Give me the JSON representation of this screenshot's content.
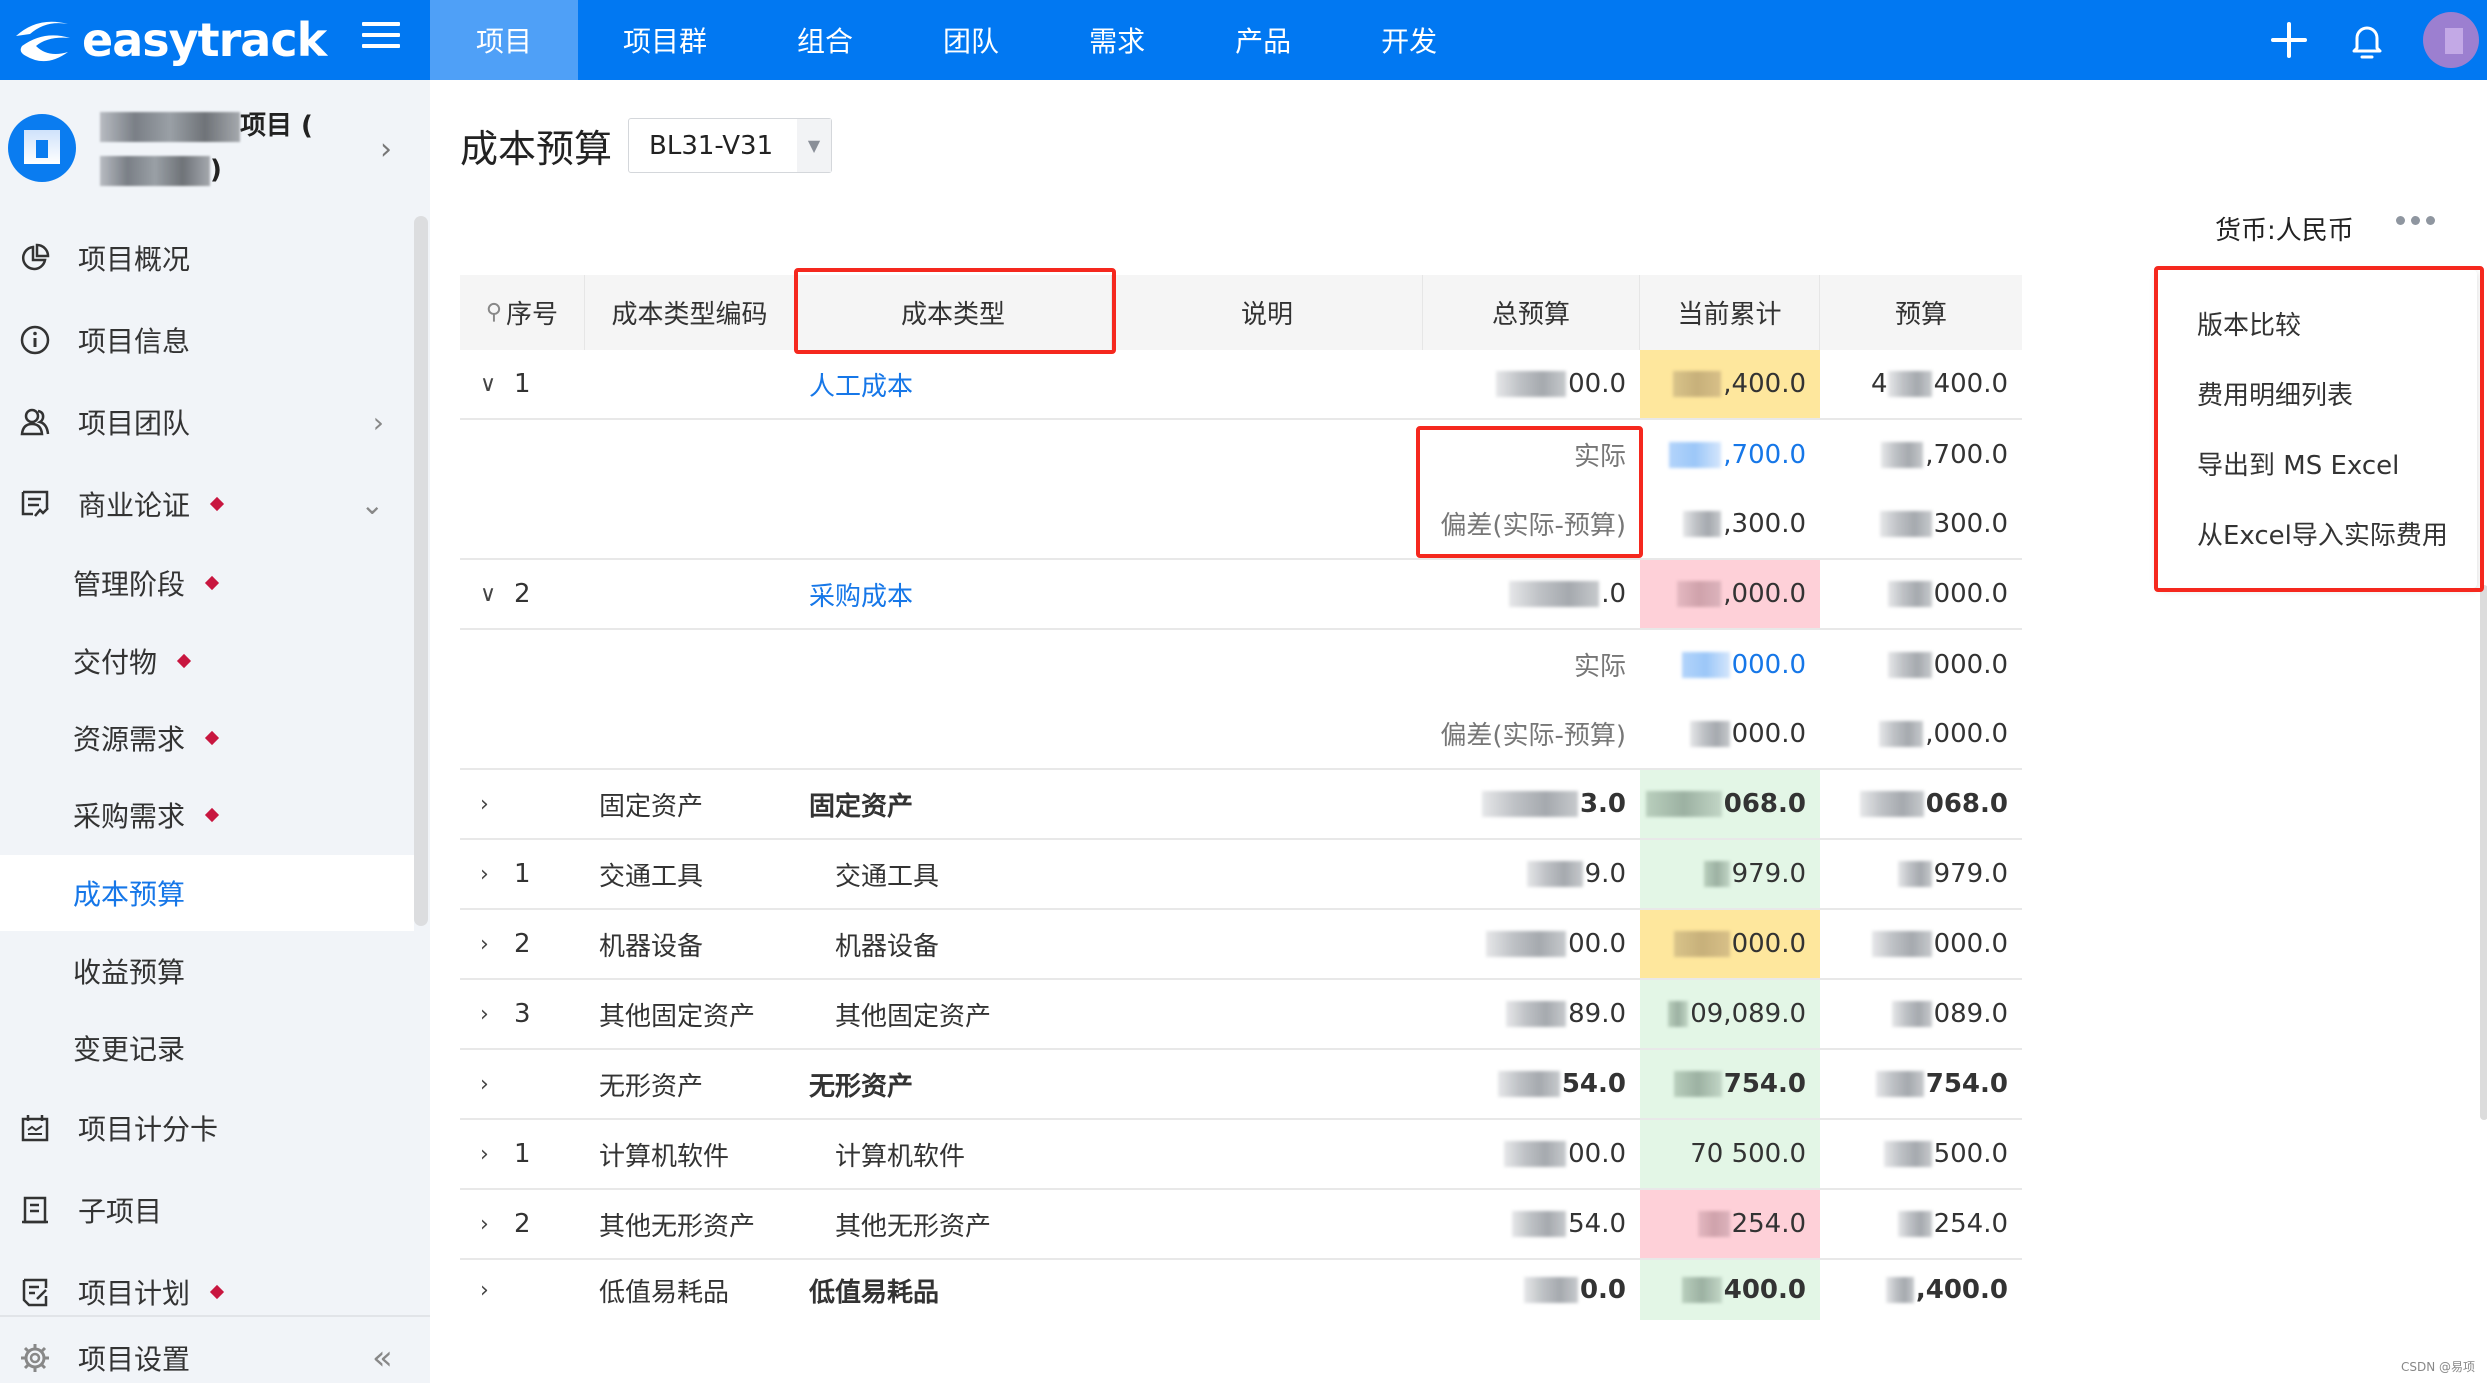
{
  "app": {
    "brand": "easytrack",
    "nav_tabs": [
      {
        "label": "项目",
        "active": true
      },
      {
        "label": "项目群"
      },
      {
        "label": "组合"
      },
      {
        "label": "团队"
      },
      {
        "label": "需求"
      },
      {
        "label": "产品"
      },
      {
        "label": "开发"
      }
    ],
    "icons": {
      "add": "plus-icon",
      "notifications": "bell-icon",
      "user": "avatar"
    }
  },
  "sidebar": {
    "project_name_visible": "项目 (",
    "project_name_line2_visible": ")",
    "items": [
      {
        "label": "项目概况",
        "icon": "pie-chart-icon"
      },
      {
        "label": "项目信息",
        "icon": "info-icon"
      },
      {
        "label": "项目团队",
        "icon": "team-icon",
        "chevron": "›"
      },
      {
        "label": "商业论证",
        "icon": "business-case-icon",
        "marker": true,
        "chevron": "⌄"
      },
      {
        "label": "管理阶段",
        "marker": true
      },
      {
        "label": "交付物",
        "marker": true
      },
      {
        "label": "资源需求",
        "marker": true
      },
      {
        "label": "采购需求",
        "marker": true
      },
      {
        "label": "成本预算",
        "active": true
      },
      {
        "label": "收益预算"
      },
      {
        "label": "变更记录"
      },
      {
        "label": "项目计分卡",
        "icon": "scorecard-icon"
      },
      {
        "label": "子项目",
        "icon": "subproject-icon"
      },
      {
        "label": "项目计划",
        "icon": "plan-icon",
        "marker": true
      },
      {
        "label": "项目设置",
        "icon": "settings-icon"
      }
    ],
    "collapse_label": "«"
  },
  "page": {
    "title": "成本预算",
    "version_select": {
      "value": "BL31-V31"
    },
    "currency_label": "货币:人民币",
    "more_label": "更多"
  },
  "table": {
    "columns": [
      "序号",
      "成本类型编码",
      "成本类型",
      "说明",
      "总预算",
      "当前累计",
      "预算"
    ],
    "sub_labels": {
      "actual": "实际",
      "variance": "偏差(实际-预算)"
    },
    "rows": [
      {
        "seq": "1",
        "expanded": true,
        "code": "",
        "type": "人工成本",
        "style": "link",
        "total": "00.0",
        "current": ",400.0",
        "current_bg": "yellow",
        "budget": "400.0",
        "actual": {
          "current": ",700.0",
          "budget": ",700.0"
        },
        "variance": {
          "current": ",300.0",
          "budget": "300.0"
        }
      },
      {
        "seq": "2",
        "expanded": true,
        "code": "",
        "type": "采购成本",
        "style": "link",
        "total": ".0",
        "current": ",000.0",
        "current_bg": "pink",
        "budget": "000.0",
        "actual": {
          "current": "000.0",
          "budget": "000.0"
        },
        "variance": {
          "current": "000.0",
          "budget": ",000.0"
        }
      },
      {
        "seq": "",
        "code": "固定资产",
        "type": "固定资产",
        "style": "bold",
        "total": "3.0",
        "current": "068.0",
        "current_bg": "green",
        "budget": "068.0"
      },
      {
        "seq": "1",
        "code": "交通工具",
        "type": "交通工具",
        "style": "indent",
        "total": "9.0",
        "current": "979.0",
        "current_bg": "green",
        "budget": "979.0"
      },
      {
        "seq": "2",
        "code": "机器设备",
        "type": "机器设备",
        "style": "indent",
        "total": "00.0",
        "current": "000.0",
        "current_bg": "yellow",
        "budget": "000.0"
      },
      {
        "seq": "3",
        "code": "其他固定资产",
        "type": "其他固定资产",
        "style": "indent",
        "total": "89.0",
        "current": "09,089.0",
        "current_bg": "green",
        "budget": "089.0"
      },
      {
        "seq": "",
        "code": "无形资产",
        "type": "无形资产",
        "style": "bold",
        "total": "54.0",
        "current": "754.0",
        "current_bg": "green",
        "budget": "754.0"
      },
      {
        "seq": "1",
        "code": "计算机软件",
        "type": "计算机软件",
        "style": "indent",
        "total": "00.0",
        "current": "70 500.0",
        "current_bg": "green",
        "budget": "500.0"
      },
      {
        "seq": "2",
        "code": "其他无形资产",
        "type": "其他无形资产",
        "style": "indent",
        "total": "54.0",
        "current": "254.0",
        "current_bg": "pink",
        "budget": "254.0"
      },
      {
        "seq": "",
        "code": "低值易耗品",
        "type": "低值易耗品",
        "style": "bold",
        "total": "0.0",
        "current": "400.0",
        "current_bg": "green",
        "budget": ",400.0"
      }
    ]
  },
  "dropdown_menu": {
    "items": [
      "版本比较",
      "费用明细列表",
      "导出到 MS Excel",
      "从Excel导入实际费用"
    ]
  },
  "colors": {
    "topbar": "#0178F2",
    "active_tab": "#4FA0F7",
    "link": "#1677E8",
    "marker": "#C8163F",
    "highlight_yellow": "#FEE79D",
    "highlight_pink": "#FED0D8",
    "highlight_green": "#E3F6E6",
    "annotation_red": "#F5281E"
  },
  "watermark": "CSDN @易项"
}
